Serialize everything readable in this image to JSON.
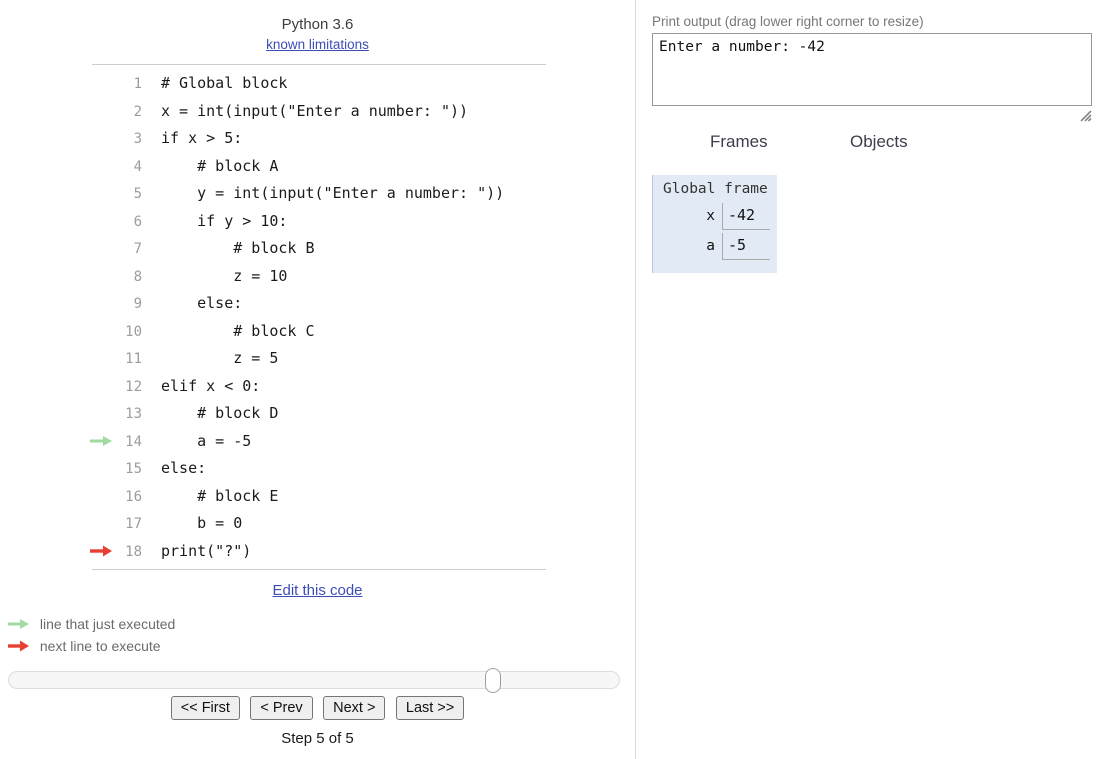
{
  "header": {
    "language": "Python 3.6",
    "limitations_link": "known limitations"
  },
  "code": {
    "lines": [
      {
        "num": "1",
        "text": "# Global block",
        "arrow": ""
      },
      {
        "num": "2",
        "text": "x = int(input(\"Enter a number: \"))",
        "arrow": ""
      },
      {
        "num": "3",
        "text": "if x > 5:",
        "arrow": ""
      },
      {
        "num": "4",
        "text": "    # block A",
        "arrow": ""
      },
      {
        "num": "5",
        "text": "    y = int(input(\"Enter a number: \"))",
        "arrow": ""
      },
      {
        "num": "6",
        "text": "    if y > 10:",
        "arrow": ""
      },
      {
        "num": "7",
        "text": "        # block B",
        "arrow": ""
      },
      {
        "num": "8",
        "text": "        z = 10",
        "arrow": ""
      },
      {
        "num": "9",
        "text": "    else:",
        "arrow": ""
      },
      {
        "num": "10",
        "text": "        # block C",
        "arrow": ""
      },
      {
        "num": "11",
        "text": "        z = 5",
        "arrow": ""
      },
      {
        "num": "12",
        "text": "elif x < 0:",
        "arrow": ""
      },
      {
        "num": "13",
        "text": "    # block D",
        "arrow": ""
      },
      {
        "num": "14",
        "text": "    a = -5",
        "arrow": "just-executed"
      },
      {
        "num": "15",
        "text": "else:",
        "arrow": ""
      },
      {
        "num": "16",
        "text": "    # block E",
        "arrow": ""
      },
      {
        "num": "17",
        "text": "    b = 0",
        "arrow": ""
      },
      {
        "num": "18",
        "text": "print(\"?\")",
        "arrow": "next-to-execute"
      }
    ]
  },
  "edit_link": "Edit this code",
  "legend": {
    "just_executed": "line that just executed",
    "next_to_execute": "next line to execute"
  },
  "slider": {
    "position_percent": 80
  },
  "nav": {
    "first": "<< First",
    "prev": "< Prev",
    "next": "Next >",
    "last": "Last >>",
    "step_label": "Step 5 of 5"
  },
  "print_output": {
    "label": "Print output (drag lower right corner to resize)",
    "text": "Enter a number: -42"
  },
  "visualizer": {
    "frames_header": "Frames",
    "objects_header": "Objects",
    "global_frame": {
      "title": "Global frame",
      "variables": [
        {
          "name": "x",
          "value": "-42"
        },
        {
          "name": "a",
          "value": "-5"
        }
      ]
    }
  },
  "colors": {
    "just_executed_arrow": "#a2dba2",
    "next_arrow": "#e93f33",
    "link": "#3d4db7",
    "frame_bg": "#e2eaf5"
  }
}
